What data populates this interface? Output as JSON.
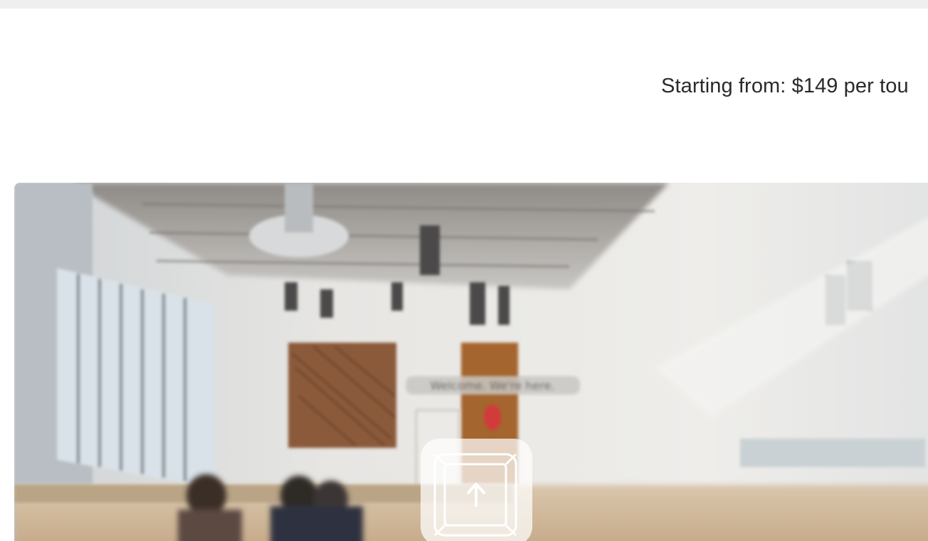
{
  "header": {
    "price_text": "Starting from: $149 per tou"
  },
  "hero": {
    "sign_text": "Welcome. We're here.",
    "share_icon": "share-upload-icon",
    "colors": {
      "wall": "#e4e3e0",
      "wood": "#a5652f",
      "artwork": "#8a5a3a",
      "exit_sign": "#d23a3a"
    }
  }
}
